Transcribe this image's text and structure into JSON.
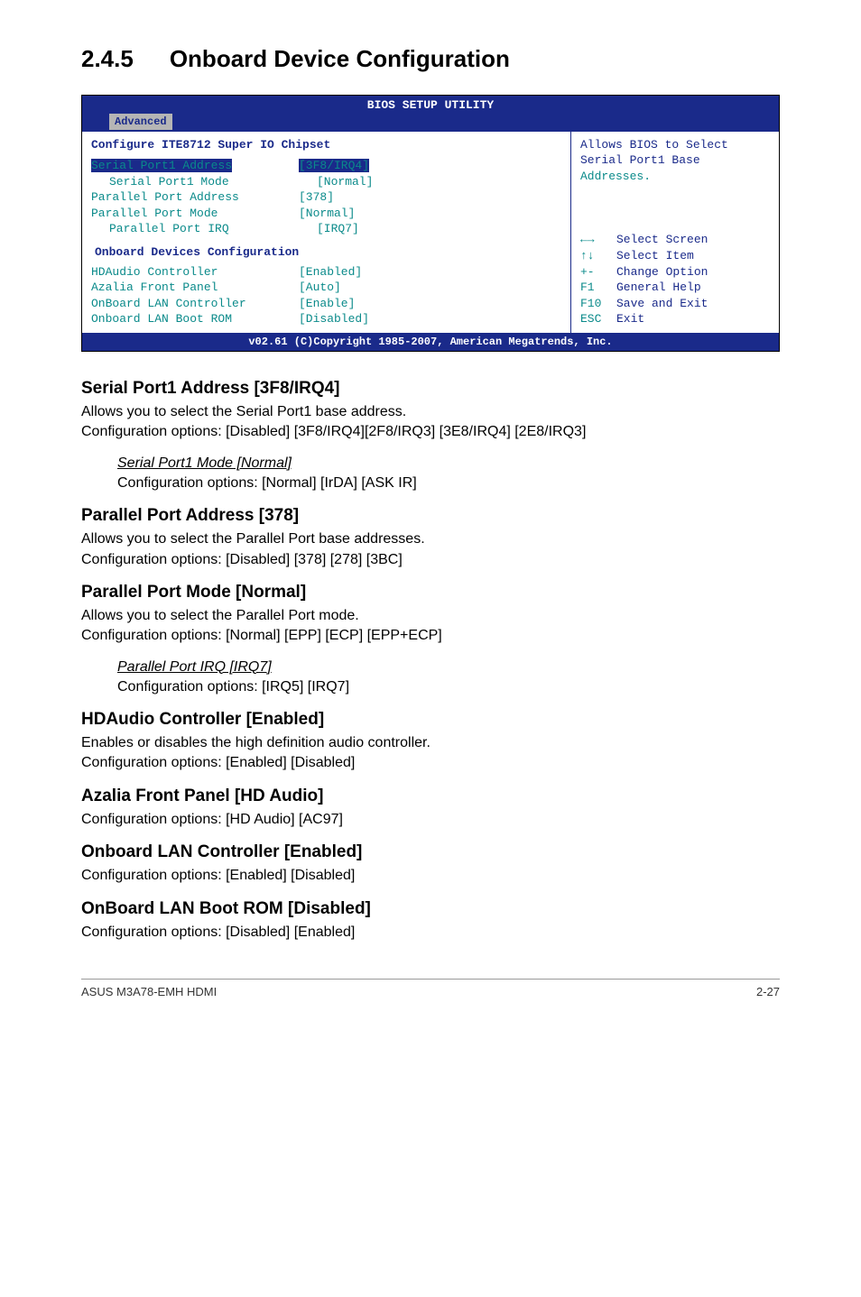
{
  "section": {
    "number": "2.4.5",
    "title": "Onboard Device Configuration"
  },
  "bios": {
    "title": "BIOS SETUP UTILITY",
    "tab": "Advanced",
    "configure_line": "Configure ITE8712 Super IO Chipset",
    "rows": [
      {
        "label": "Serial Port1 Address",
        "value": "[3F8/IRQ4]",
        "selected": true
      },
      {
        "label": "Serial Port1 Mode",
        "value": "[Normal]",
        "indent": true
      },
      {
        "label": "Parallel Port Address",
        "value": "[378]"
      },
      {
        "label": "Parallel Port Mode",
        "value": "[Normal]"
      },
      {
        "label": "Parallel Port IRQ",
        "value": "[IRQ7]",
        "indent": true
      }
    ],
    "subheader": "Onboard Devices Configuration",
    "rows2": [
      {
        "label": "HDAudio Controller",
        "value": "[Enabled]"
      },
      {
        "label": "Azalia Front Panel",
        "value": "[Auto]"
      },
      {
        "label": "OnBoard LAN Controller",
        "value": "[Enable]"
      },
      {
        "label": "Onboard LAN Boot ROM",
        "value": "[Disabled]"
      }
    ],
    "help_top1": "Allows BIOS to Select",
    "help_top2": "Serial Port1 Base",
    "help_top3": "Addresses.",
    "keys": [
      {
        "k": "←→",
        "d": "Select Screen",
        "arrow": true
      },
      {
        "k": "↑↓",
        "d": "Select Item",
        "arrow": true
      },
      {
        "k": "+-",
        "d": "Change Option"
      },
      {
        "k": "F1",
        "d": "General Help"
      },
      {
        "k": "F10",
        "d": "Save and Exit"
      },
      {
        "k": "ESC",
        "d": "Exit"
      }
    ],
    "footer": "v02.61 (C)Copyright 1985-2007, American Megatrends, Inc."
  },
  "paras": {
    "sp1_h": "Serial Port1 Address [3F8/IRQ4]",
    "sp1_p1": "Allows you to select the Serial Port1 base address.",
    "sp1_p2": "Configuration options: [Disabled] [3F8/IRQ4][2F8/IRQ3] [3E8/IRQ4] [2E8/IRQ3]",
    "sp1_sub_h": "Serial Port1 Mode [Normal]",
    "sp1_sub_p": "Configuration options: [Normal] [IrDA] [ASK IR]",
    "pp_h": "Parallel Port Address [378]",
    "pp_p1": "Allows you to select the Parallel Port base addresses.",
    "pp_p2": "Configuration options: [Disabled] [378] [278] [3BC]",
    "ppm_h": "Parallel Port Mode [Normal]",
    "ppm_p1": "Allows you to select the Parallel Port  mode.",
    "ppm_p2": "Configuration options: [Normal] [EPP] [ECP] [EPP+ECP]",
    "ppm_sub_h": "Parallel Port IRQ [IRQ7]",
    "ppm_sub_p": "Configuration options: [IRQ5] [IRQ7]",
    "hd_h": "HDAudio Controller [Enabled]",
    "hd_p1": "Enables or disables the high definition audio controller.",
    "hd_p2": "Configuration options: [Enabled] [Disabled]",
    "az_h": "Azalia Front Panel [HD Audio]",
    "az_p": "Configuration options: [HD Audio] [AC97]",
    "lan_h": "Onboard LAN Controller [Enabled]",
    "lan_p": "Configuration options: [Enabled] [Disabled]",
    "rom_h": "OnBoard LAN Boot ROM [Disabled]",
    "rom_p": "Configuration options: [Disabled] [Enabled]"
  },
  "footer": {
    "left": "ASUS M3A78-EMH HDMI",
    "right": "2-27"
  }
}
